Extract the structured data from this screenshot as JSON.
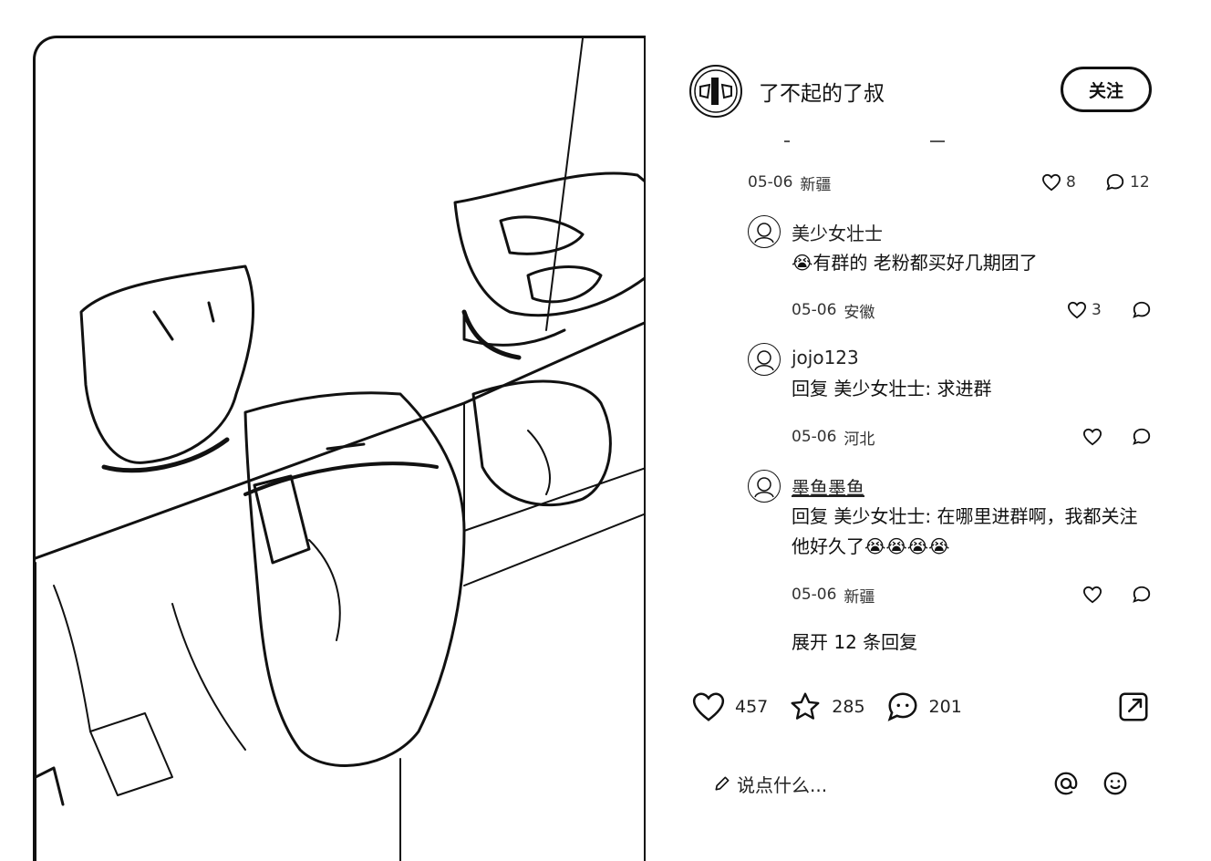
{
  "author": {
    "name": "了不起的了叔",
    "follow_label": "关注"
  },
  "reply_thread": {
    "date": "05-06",
    "location": "新疆",
    "likes": "8",
    "replies": "12"
  },
  "comments": [
    {
      "name": "美少女壮士",
      "text": "有群的 老粉都买好几期团了",
      "date": "05-06",
      "location": "安徽",
      "likes": "3",
      "leading_emoji": "😭"
    },
    {
      "name": "jojo123",
      "text": "回复 美少女壮士: 求进群",
      "date": "05-06",
      "location": "河北",
      "likes": ""
    },
    {
      "name": "墨鱼墨鱼",
      "text": "回复 美少女壮士: 在哪里进群啊，我都关注他好久了😭😭😭😭",
      "date": "05-06",
      "location": "新疆",
      "likes": ""
    }
  ],
  "expand_label": "展开 12 条回复",
  "actions": {
    "likes": "457",
    "favorites": "285",
    "comments": "201"
  },
  "input": {
    "placeholder": "说点什么..."
  },
  "icons": {
    "like": "heart-icon",
    "favorite": "star-icon",
    "comment": "comment-bubble-icon",
    "share": "share-icon",
    "mention": "at-icon",
    "emoji": "smiley-icon",
    "edit": "pencil-icon"
  },
  "colors": {
    "text": "#111111",
    "meta": "#333333",
    "background": "#ffffff"
  }
}
